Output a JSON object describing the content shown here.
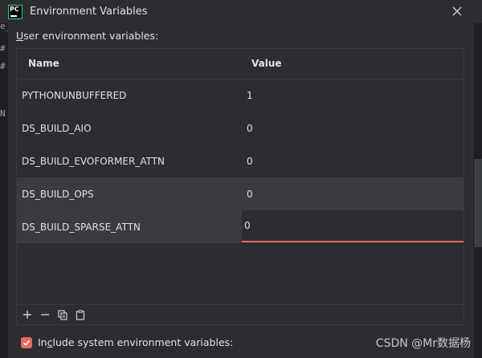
{
  "window": {
    "title": "Environment Variables"
  },
  "background": {
    "glyphs": [
      "e_",
      "#",
      "#",
      "N"
    ]
  },
  "section": {
    "label_prefix": "",
    "label_mnemonic": "U",
    "label_rest": "ser environment variables:"
  },
  "table": {
    "columns": [
      "Name",
      "Value"
    ],
    "rows": [
      {
        "name": "PYTHONUNBUFFERED",
        "value": "1"
      },
      {
        "name": "DS_BUILD_AIO",
        "value": "0"
      },
      {
        "name": "DS_BUILD_EVOFORMER_ATTN",
        "value": "0"
      },
      {
        "name": "DS_BUILD_OPS",
        "value": "0"
      },
      {
        "name": "DS_BUILD_SPARSE_ATTN",
        "value": "0"
      }
    ],
    "selected_row": 3,
    "editing_row": 4
  },
  "toolbar": {
    "add": "+",
    "remove": "−"
  },
  "include_system": {
    "checked": true,
    "label_prefix": "In",
    "label_mnemonic": "c",
    "label_rest": "lude system environment variables:"
  },
  "watermark": "CSDN @Mr数据杨",
  "colors": {
    "accent": "#e66c5b",
    "background": "#2b2d30",
    "selected_row": "#393b40"
  }
}
